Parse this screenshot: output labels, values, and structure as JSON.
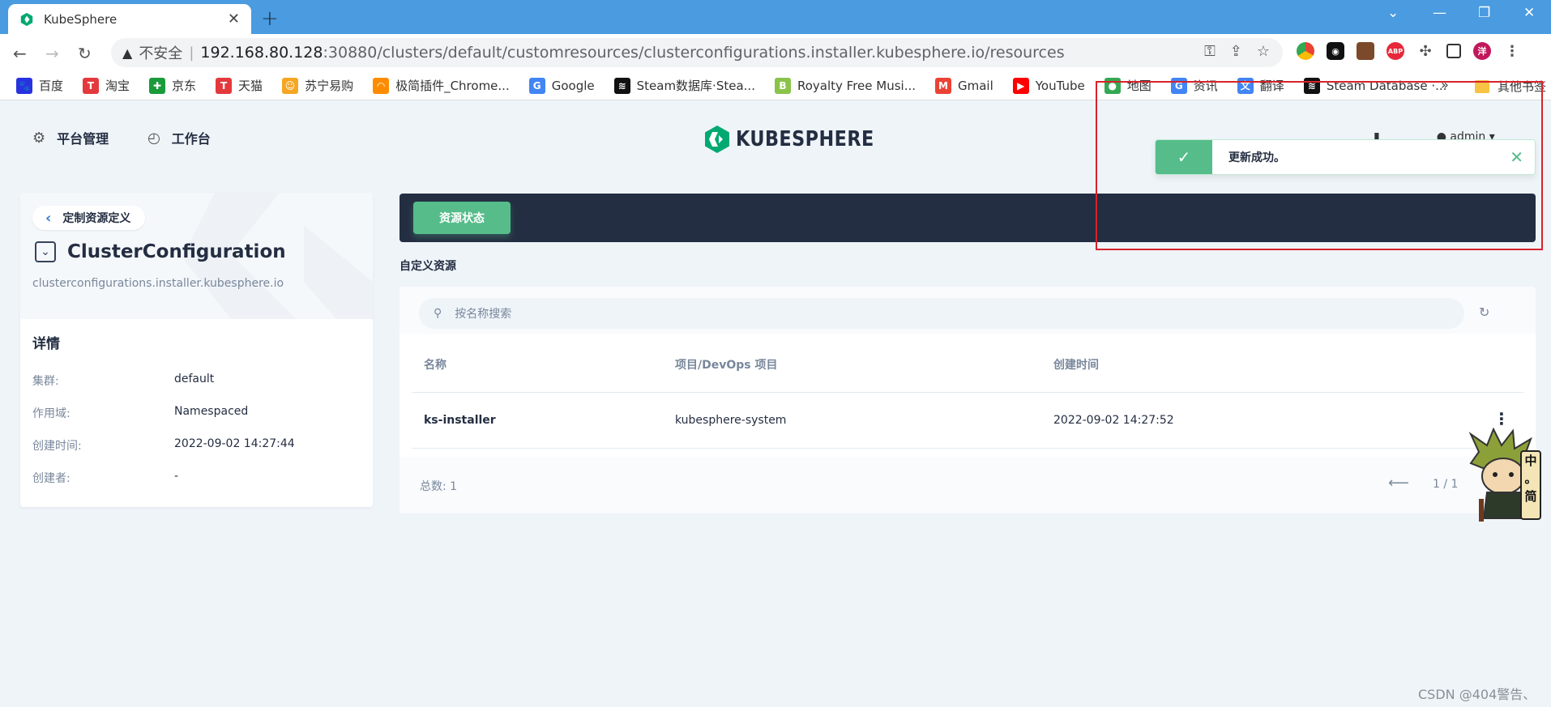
{
  "browser": {
    "tab_title": "KubeSphere",
    "tab_close": "✕",
    "new_tab": "+",
    "insecure_label": "不安全",
    "url_host": "192.168.80.128",
    "url_path": ":30880/clusters/default/customresources/clusterconfigurations.installer.kubesphere.io/resources",
    "profile_initial": "洋",
    "bookmarks": [
      {
        "label": "百度",
        "color": "#2932e1",
        "glyph": "🐾"
      },
      {
        "label": "淘宝",
        "color": "#e4393c",
        "glyph": "T"
      },
      {
        "label": "京东",
        "color": "#1a9b3b",
        "glyph": "✚"
      },
      {
        "label": "天猫",
        "color": "#e4393c",
        "glyph": "T"
      },
      {
        "label": "苏宁易购",
        "color": "#f5a623",
        "glyph": "☺"
      },
      {
        "label": "极简插件_Chrome...",
        "color": "#ff8c00",
        "glyph": "◠"
      },
      {
        "label": "Google",
        "color": "#4285f4",
        "glyph": "G"
      },
      {
        "label": "Steam数据库·Stea...",
        "color": "#111111",
        "glyph": "≋"
      },
      {
        "label": "Royalty Free Musi...",
        "color": "#8bc34a",
        "glyph": "B"
      },
      {
        "label": "Gmail",
        "color": "#ea4335",
        "glyph": "M"
      },
      {
        "label": "YouTube",
        "color": "#ff0000",
        "glyph": "▶"
      },
      {
        "label": "地图",
        "color": "#34a853",
        "glyph": "●"
      },
      {
        "label": "资讯",
        "color": "#4285f4",
        "glyph": "G"
      },
      {
        "label": "翻译",
        "color": "#4285f4",
        "glyph": "文"
      },
      {
        "label": "Steam Database ·...",
        "color": "#111111",
        "glyph": "≋"
      }
    ],
    "bookmarks_more": "»",
    "other_bookmarks": "其他书签"
  },
  "header": {
    "platform_label": "平台管理",
    "workbench_label": "工作台",
    "logo_text": "KUBESPHERE",
    "user_name": "admin"
  },
  "sidebar": {
    "back_label": "定制资源定义",
    "resource_name": "ClusterConfiguration",
    "resource_group": "clusterconfigurations.installer.kubesphere.io",
    "details_title": "详情",
    "details": [
      {
        "key": "集群:",
        "value": "default"
      },
      {
        "key": "作用域:",
        "value": "Namespaced"
      },
      {
        "key": "创建时间:",
        "value": "2022-09-02 14:27:44"
      },
      {
        "key": "创建者:",
        "value": "-"
      }
    ]
  },
  "main": {
    "status_button": "资源状态",
    "section_title": "自定义资源",
    "search_placeholder": "按名称搜索",
    "columns": [
      "名称",
      "项目/DevOps 项目",
      "创建时间"
    ],
    "rows": [
      {
        "name": "ks-installer",
        "project": "kubesphere-system",
        "created": "2022-09-02 14:27:52"
      }
    ],
    "total_label": "总数: 1",
    "page_info": "1 / 1"
  },
  "toast": {
    "message": "更新成功。"
  },
  "mascot_badge": "中\n。\n简",
  "watermark": "CSDN @404警告、",
  "colors": {
    "accent": "#55bc8a",
    "dark": "#242e42",
    "muted": "#79879c",
    "highlight": "#d9222a"
  }
}
